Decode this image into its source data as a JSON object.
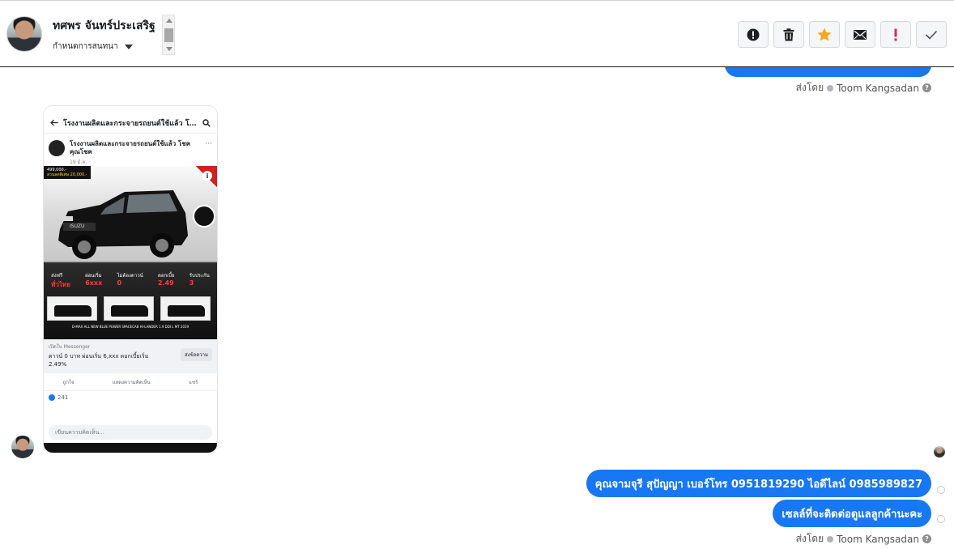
{
  "header": {
    "contact_name": "ทศพร จันทร์ประเสริฐ",
    "assign_label": "กำหนดการสนทนา"
  },
  "toolbar": {
    "buttons": [
      {
        "name": "mark-spam",
        "icon": "alert-circle-icon"
      },
      {
        "name": "delete",
        "icon": "trash-icon"
      },
      {
        "name": "star",
        "icon": "star-icon",
        "color": "#f5a623"
      },
      {
        "name": "mark-unread",
        "icon": "mail-icon"
      },
      {
        "name": "follow-up",
        "icon": "exclamation-icon",
        "color": "#e0245e"
      },
      {
        "name": "mark-done",
        "icon": "check-icon"
      }
    ]
  },
  "colors": {
    "bubble": "#1877f2",
    "border": "#d6d8dc"
  },
  "messages": {
    "sent_by_label": "ส่งโดย",
    "sender_name": "Toom Kangsadan",
    "outgoing": [
      "คุณจามจุรี สุปัญญา เบอร์โทร 0951819290  ไอดีไลน์ 0985989827",
      "เซลล์ที่จะติดต่อดูแลลูกค้านะคะ"
    ]
  },
  "attachment": {
    "nav_title": "โรงงานผลิตและกระจายรถยนต์ใช้แล้ว โชค...",
    "page_name": "โรงงานผลิตและกระจายรถยนต์ใช้แล้ว โชค คุณโชค",
    "post_date": "19 มี.ค. · ",
    "price_tag": "499,000.-",
    "discount_tag": "ส่วนลดพิเศษ 20,000.-",
    "brand": "ISUZU",
    "feature_labels": [
      {
        "top": "ส่งฟรี",
        "big": "ทั่วไทย"
      },
      {
        "top": "ผ่อนเริ่ม",
        "big": "6xxx"
      },
      {
        "top": "ไม่ต้องดาวน์",
        "big": "0"
      },
      {
        "top": "ดอกเบี้ย",
        "big": "2.49"
      },
      {
        "top": "รับประกัน",
        "big": "3"
      }
    ],
    "model_caption": "D-MAX ALL NEW BLUE POWER SPACECAB HI-LANDER 1.9 DDI L MT 2019",
    "cta_small": "เปิดใน Messenger",
    "cta_text": "ดาวน์ 0 บาท ผ่อนเริ่ม 6,xxx ดอกเบี้ยเริ่ม 2.49%",
    "cta_button": "ส่งข้อความ",
    "action_like": "ถูกใจ",
    "action_comment": "แสดงความคิดเห็น",
    "action_share": "แชร์",
    "likes_count": "241",
    "comment_placeholder": "เขียนความคิดเห็น..."
  }
}
